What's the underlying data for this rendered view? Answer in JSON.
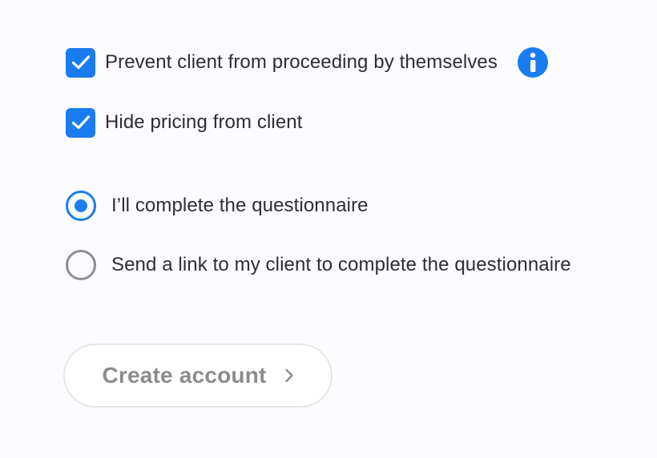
{
  "options": {
    "prevent_proceeding": {
      "label": "Prevent client from proceeding by themselves",
      "checked": true,
      "info_icon": "info-icon"
    },
    "hide_pricing": {
      "label": "Hide pricing from client",
      "checked": true
    }
  },
  "questionnaire": {
    "selected": "self",
    "choices": [
      {
        "id": "self",
        "label": "I’ll complete the questionnaire",
        "selected": true
      },
      {
        "id": "client",
        "label": "Send a link to my client to complete the questionnaire",
        "selected": false
      }
    ]
  },
  "submit": {
    "label": "Create account",
    "icon": "chevron-right-icon",
    "enabled": false
  },
  "colors": {
    "accent": "#1a7cf0",
    "text": "#2d2d33",
    "muted": "#8c8c90",
    "radio_off": "#8d8d93",
    "background": "#fcfbfd"
  }
}
